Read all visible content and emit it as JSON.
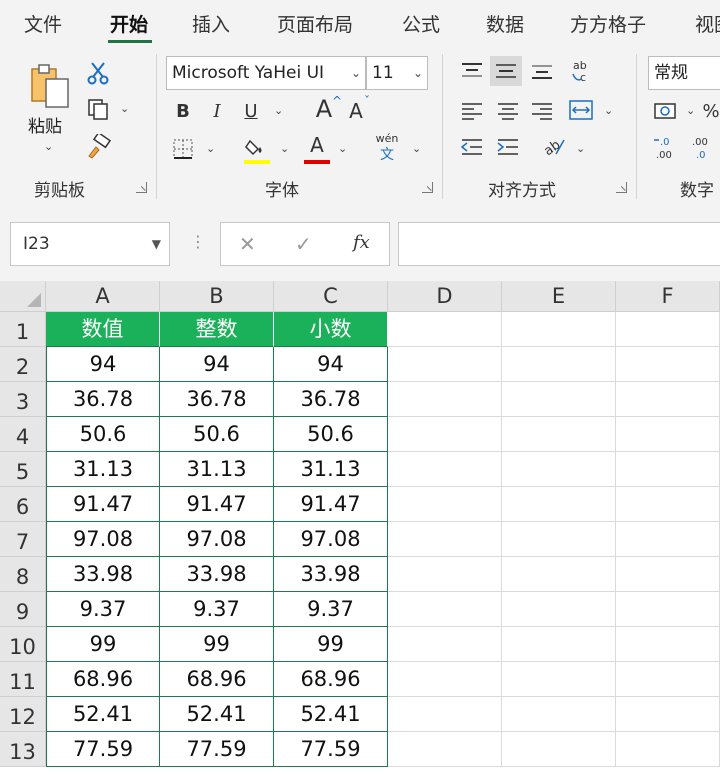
{
  "ribbon_tabs": [
    {
      "label": "文件",
      "active": false
    },
    {
      "label": "开始",
      "active": true
    },
    {
      "label": "插入",
      "active": false
    },
    {
      "label": "页面布局",
      "active": false
    },
    {
      "label": "公式",
      "active": false
    },
    {
      "label": "数据",
      "active": false
    },
    {
      "label": "方方格子",
      "active": false
    },
    {
      "label": "视图",
      "active": false
    }
  ],
  "clipboard": {
    "paste_label": "粘贴",
    "group_label": "剪贴板"
  },
  "font": {
    "name": "Microsoft YaHei UI",
    "size": "11",
    "bold": "B",
    "italic": "I",
    "underline": "U",
    "grow": "A",
    "shrink": "A",
    "phonetic_top": "wén",
    "phonetic_bottom": "文",
    "fill_color": "#ffff00",
    "font_color": "#e00000",
    "group_label": "字体"
  },
  "alignment": {
    "group_label": "对齐方式"
  },
  "number": {
    "format": "常规",
    "group_label": "数字"
  },
  "formula_bar": {
    "name_box": "I23",
    "cancel": "✕",
    "enter": "✓",
    "fx": "fx",
    "formula": ""
  },
  "sheet": {
    "columns": [
      "A",
      "B",
      "C",
      "D",
      "E",
      "F"
    ],
    "rows": [
      "1",
      "2",
      "3",
      "4",
      "5",
      "6",
      "7",
      "8",
      "9",
      "10",
      "11",
      "12",
      "13"
    ],
    "header_fill": "#1bb05a",
    "headers": [
      "数值",
      "整数",
      "小数"
    ],
    "data": [
      [
        "94",
        "94",
        "94"
      ],
      [
        "36.78",
        "36.78",
        "36.78"
      ],
      [
        "50.6",
        "50.6",
        "50.6"
      ],
      [
        "31.13",
        "31.13",
        "31.13"
      ],
      [
        "91.47",
        "91.47",
        "91.47"
      ],
      [
        "97.08",
        "97.08",
        "97.08"
      ],
      [
        "33.98",
        "33.98",
        "33.98"
      ],
      [
        "9.37",
        "9.37",
        "9.37"
      ],
      [
        "99",
        "99",
        "99"
      ],
      [
        "68.96",
        "68.96",
        "68.96"
      ],
      [
        "52.41",
        "52.41",
        "52.41"
      ],
      [
        "77.59",
        "77.59",
        "77.59"
      ]
    ]
  }
}
